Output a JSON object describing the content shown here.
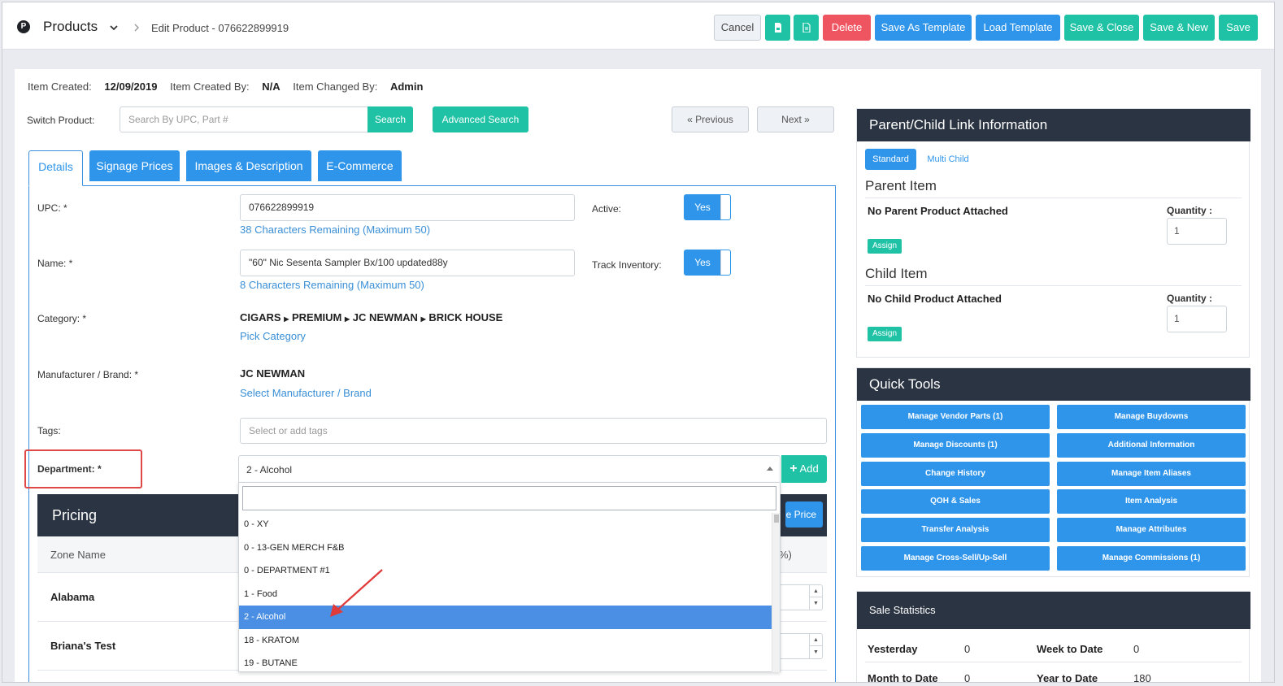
{
  "header": {
    "logo_letter": "P",
    "app_title": "Products",
    "breadcrumb": "Edit Product - 076622899919",
    "buttons": {
      "cancel": "Cancel",
      "delete": "Delete",
      "save_as_template": "Save As Template",
      "load_template": "Load Template",
      "save_close": "Save & Close",
      "save_new": "Save & New",
      "save": "Save"
    }
  },
  "meta": {
    "created_label": "Item Created:",
    "created_value": "12/09/2019",
    "created_by_label": "Item Created By:",
    "created_by_value": "N/A",
    "changed_by_label": "Item Changed By:",
    "changed_by_value": "Admin"
  },
  "switch": {
    "label": "Switch Product:",
    "placeholder": "Search By UPC, Part #",
    "search_btn": "Search",
    "advanced_btn": "Advanced Search",
    "prev_btn": "« Previous",
    "next_btn": "Next »"
  },
  "tabs": [
    "Details",
    "Signage Prices",
    "Images & Description",
    "E-Commerce"
  ],
  "form": {
    "upc_label": "UPC: *",
    "upc_value": "076622899919",
    "upc_hint": "38 Characters Remaining (Maximum 50)",
    "active_label": "Active:",
    "active_value": "Yes",
    "name_label": "Name: *",
    "name_value": "\"60\" Nic Sesenta Sampler Bx/100 updated88y",
    "name_hint": "8 Characters Remaining (Maximum 50)",
    "track_label": "Track Inventory:",
    "track_value": "Yes",
    "category_label": "Category: *",
    "category_path": [
      "CIGARS",
      "PREMIUM",
      "JC NEWMAN",
      "BRICK HOUSE"
    ],
    "pick_category": "Pick Category",
    "brand_label": "Manufacturer / Brand: *",
    "brand_value": "JC NEWMAN",
    "select_brand": "Select Manufacturer / Brand",
    "tags_label": "Tags:",
    "tags_placeholder": "Select or add tags",
    "department_label": "Department: *",
    "department_value": "2 - Alcohol",
    "add_btn": "Add"
  },
  "department_options": [
    "0 - XY",
    "0 - 13-GEN MERCH F&B",
    "0 - DEPARTMENT #1",
    "1 - Food",
    "2 - Alcohol",
    "18 - KRATOM",
    "19 - BUTANE"
  ],
  "department_selected_index": 4,
  "pricing": {
    "title": "Pricing",
    "price_btn_partial": "e Price",
    "zone_header": "Zone Name",
    "pct_header_partial": "%)",
    "zones": [
      "Alabama",
      "Briana's Test"
    ]
  },
  "parent_child": {
    "title": "Parent/Child Link Information",
    "mode_standard": "Standard",
    "mode_multi": "Multi Child",
    "parent_heading": "Parent Item",
    "parent_none": "No Parent Product Attached",
    "child_heading": "Child Item",
    "child_none": "No Child Product Attached",
    "qty_label": "Quantity :",
    "parent_qty": "1",
    "child_qty": "1",
    "assign_btn": "Assign"
  },
  "quick_tools": {
    "title": "Quick Tools",
    "buttons": [
      "Manage Vendor Parts (1)",
      "Manage Buydowns",
      "Manage Discounts (1)",
      "Additional Information",
      "Change History",
      "Manage Item Aliases",
      "QOH & Sales",
      "Item Analysis",
      "Transfer Analysis",
      "Manage Attributes",
      "Manage Cross-Sell/Up-Sell",
      "Manage Commissions (1)"
    ]
  },
  "sale_stats": {
    "title": "Sale Statistics",
    "yesterday_label": "Yesterday",
    "yesterday_value": "0",
    "wtd_label": "Week to Date",
    "wtd_value": "0",
    "mtd_label": "Month to Date",
    "mtd_value": "0",
    "ytd_label": "Year to Date",
    "ytd_value": "180"
  },
  "colors": {
    "accent_blue": "#2f95ea",
    "teal": "#1fc2a5",
    "danger": "#ef5561",
    "dark_header": "#2b3442"
  }
}
